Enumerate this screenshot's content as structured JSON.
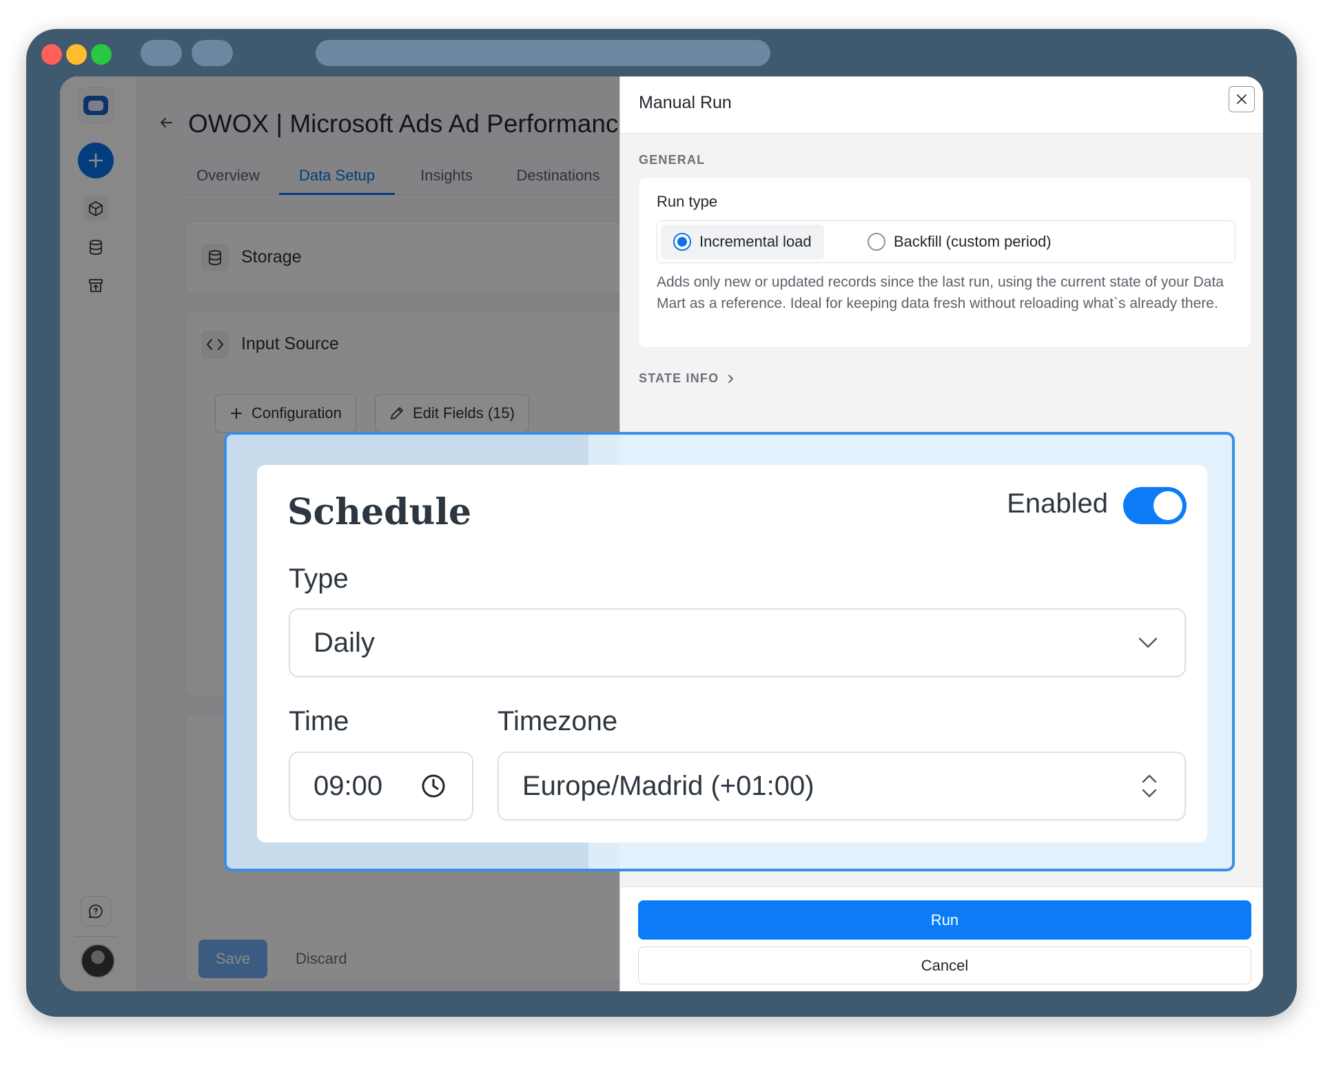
{
  "main": {
    "title": "OWOX | Microsoft Ads Ad Performance",
    "tabs": [
      {
        "label": "Overview"
      },
      {
        "label": "Data Setup"
      },
      {
        "label": "Insights"
      },
      {
        "label": "Destinations"
      }
    ],
    "storage": {
      "label": "Storage"
    },
    "input_source": {
      "label": "Input Source",
      "configuration_btn": "Configuration",
      "edit_fields_btn": "Edit Fields (15)"
    },
    "save_label": "Save",
    "discard_label": "Discard"
  },
  "manual_run": {
    "title": "Manual Run",
    "general_label": "GENERAL",
    "run_type_label": "Run type",
    "options": [
      {
        "label": "Incremental load",
        "selected": true
      },
      {
        "label": "Backfill (custom period)",
        "selected": false
      }
    ],
    "description": "Adds only new or updated records since the last run, using the current state of your Data Mart as a reference. Ideal for keeping data fresh without reloading what`s already there.",
    "state_info_label": "STATE INFO",
    "run_label": "Run",
    "cancel_label": "Cancel"
  },
  "schedule": {
    "title": "Schedule",
    "enabled_label": "Enabled",
    "enabled": true,
    "type_label": "Type",
    "type_value": "Daily",
    "time_label": "Time",
    "time_value": "09:00",
    "timezone_label": "Timezone",
    "timezone_value": "Europe/Madrid (+01:00)"
  },
  "colors": {
    "accent": "#0b7cf5",
    "highlight_border": "#3a8ee6",
    "window_frame": "#3f5a6f"
  }
}
